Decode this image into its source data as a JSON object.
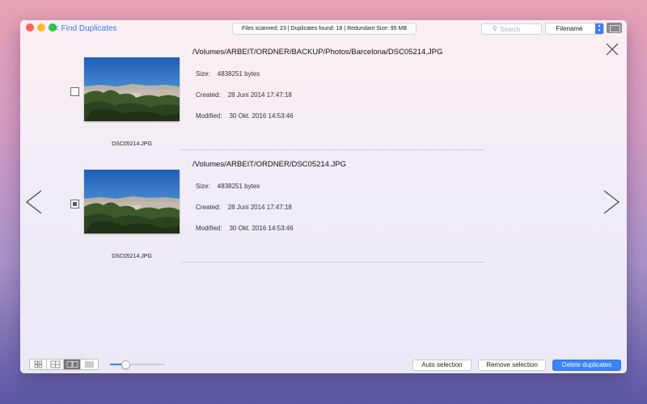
{
  "window": {
    "back_label": "< Find Duplicates",
    "status_text": "Files scanned: 23 | Duplicates found: 18 | Redundant Size: 95 MB",
    "search_placeholder": "Search",
    "sort_value": "Filename",
    "sort_options": [
      "Filename"
    ]
  },
  "labels": {
    "size": "Size:",
    "created": "Created:",
    "modified": "Modified:"
  },
  "duplicates": [
    {
      "path": "/Volumes/ARBEIT/ORDNER/BACKUP/Photos/Barcelona/DSC05214.JPG",
      "filename": "DSC05214.JPG",
      "size": "4838251 bytes",
      "created": "28 Juni 2014  17:47:18",
      "modified": "30 Okt. 2016  14:53:46",
      "checked": false
    },
    {
      "path": "/Volumes/ARBEIT/ORDNER/DSC05214.JPG",
      "filename": "DSC05214.JPG",
      "size": "4838251 bytes",
      "created": "28 Juni 2014  17:47:18",
      "modified": "30 Okt. 2016  14:53:46",
      "checked": true
    }
  ],
  "bottom": {
    "view_modes": [
      "grid-small-icon",
      "grid-large-icon",
      "compare-icon",
      "list-icon"
    ],
    "active_view": 2,
    "zoom_level": 0.27,
    "auto_selection": "Auto selection",
    "remove_selection": "Remove selection",
    "delete_duplicates": "Delete duplicates"
  },
  "colors": {
    "accent": "#3a84f3",
    "link": "#2f7ff0"
  }
}
